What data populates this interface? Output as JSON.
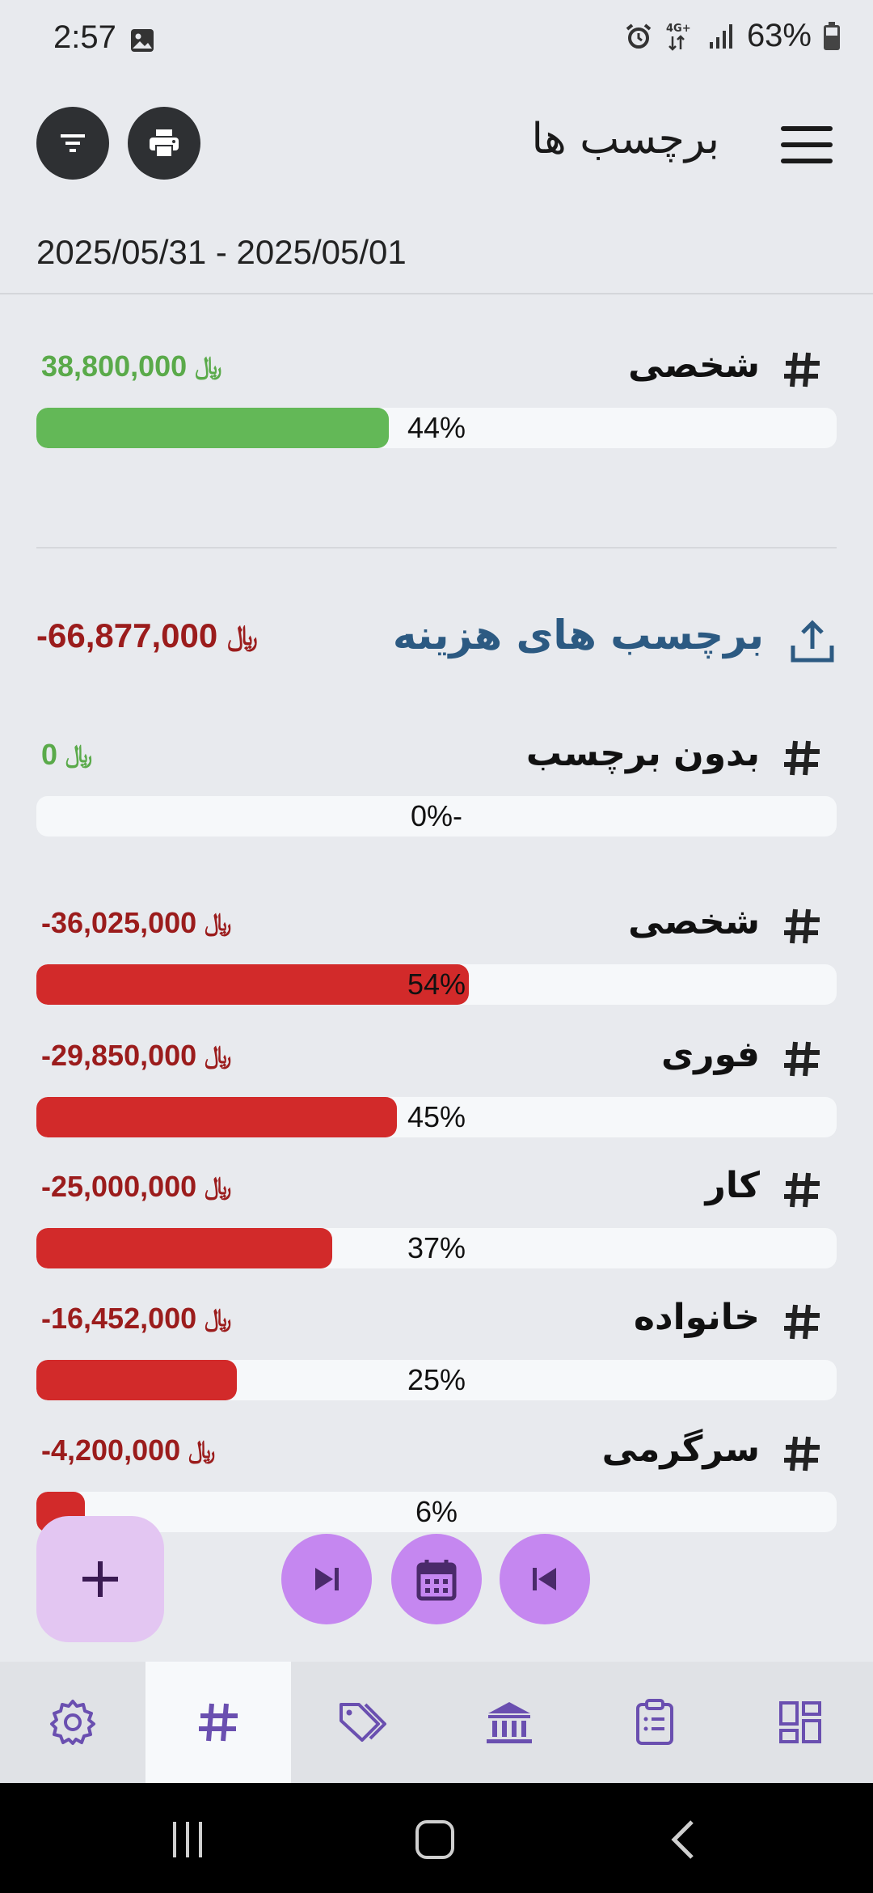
{
  "status_bar": {
    "time": "2:57",
    "battery": "63%",
    "network": "4G+"
  },
  "header": {
    "title": "برچسب ها"
  },
  "date_range": "2025/05/31 - 2025/05/01",
  "income_tags": [
    {
      "name": "شخصی",
      "amount": "38,800,000",
      "currency": "﷼",
      "percent_label": "44%",
      "percent": 44,
      "color": "#63b857"
    }
  ],
  "expense_section": {
    "title": "برچسب های هزینه",
    "total": "-66,877,000",
    "currency": "﷼"
  },
  "expense_tags": [
    {
      "name": "بدون برچسب",
      "amount": "0",
      "currency": "﷼",
      "percent_label": "0%-",
      "percent": 0,
      "color": "#d22a2a",
      "amount_type": "pos"
    },
    {
      "name": "شخصی",
      "amount": "-36,025,000",
      "currency": "﷼",
      "percent_label": "54%",
      "percent": 54,
      "color": "#d22a2a",
      "amount_type": "neg"
    },
    {
      "name": "فوری",
      "amount": "-29,850,000",
      "currency": "﷼",
      "percent_label": "45%",
      "percent": 45,
      "color": "#d22a2a",
      "amount_type": "neg"
    },
    {
      "name": "کار",
      "amount": "-25,000,000",
      "currency": "﷼",
      "percent_label": "37%",
      "percent": 37,
      "color": "#d22a2a",
      "amount_type": "neg"
    },
    {
      "name": "خانواده",
      "amount": "-16,452,000",
      "currency": "﷼",
      "percent_label": "25%",
      "percent": 25,
      "color": "#d22a2a",
      "amount_type": "neg"
    },
    {
      "name": "سرگرمی",
      "amount": "-4,200,000",
      "currency": "﷼",
      "percent_label": "6%",
      "percent": 6,
      "color": "#d22a2a",
      "amount_type": "neg"
    }
  ],
  "bottom_tabs": [
    {
      "icon": "gear-icon",
      "active": false
    },
    {
      "icon": "hash-icon",
      "active": true
    },
    {
      "icon": "tags-icon",
      "active": false
    },
    {
      "icon": "bank-icon",
      "active": false
    },
    {
      "icon": "clipboard-icon",
      "active": false
    },
    {
      "icon": "dashboard-icon",
      "active": false
    }
  ],
  "colors": {
    "accent": "#6a4fb0",
    "income": "#5aaa4a",
    "expense": "#9b1c1c",
    "section_title": "#2c5a82"
  }
}
